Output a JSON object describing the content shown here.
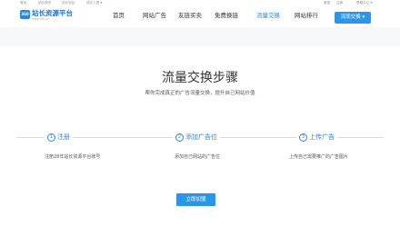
{
  "topbar": {
    "links": [
      "首页",
      "站长资讯",
      "站长社区",
      "站长工具 ▾"
    ],
    "right": [
      "登录",
      "注册",
      "帮助中心 ▾"
    ]
  },
  "brand": {
    "logo_badge": "360",
    "name": "站长资源平台",
    "sub": "www.360.cn"
  },
  "nav": {
    "items": [
      "首页",
      "网站广告",
      "友链买卖",
      "免费换链",
      "流量交换",
      "网站排行"
    ],
    "active": "流量交换",
    "button_label": "流而交换 ▾"
  },
  "main": {
    "title": "流量交换步骤",
    "subtitle": "帮你完成真正的广告流量交换，提升自己网站价值",
    "steps": [
      {
        "num": "1",
        "label": "注册",
        "desc": "注册28年站长资源平台账号"
      },
      {
        "num": "2",
        "label": "添加广告位",
        "desc": "添加自己网站的广告位"
      },
      {
        "num": "3",
        "label": "上传广告",
        "desc": "上传自己需要推广的广告图片"
      }
    ],
    "cta_label": "立即加盟"
  },
  "colors": {
    "accent": "#2b86e0",
    "button": "#2b96e8",
    "band": "#f7f8fa"
  }
}
